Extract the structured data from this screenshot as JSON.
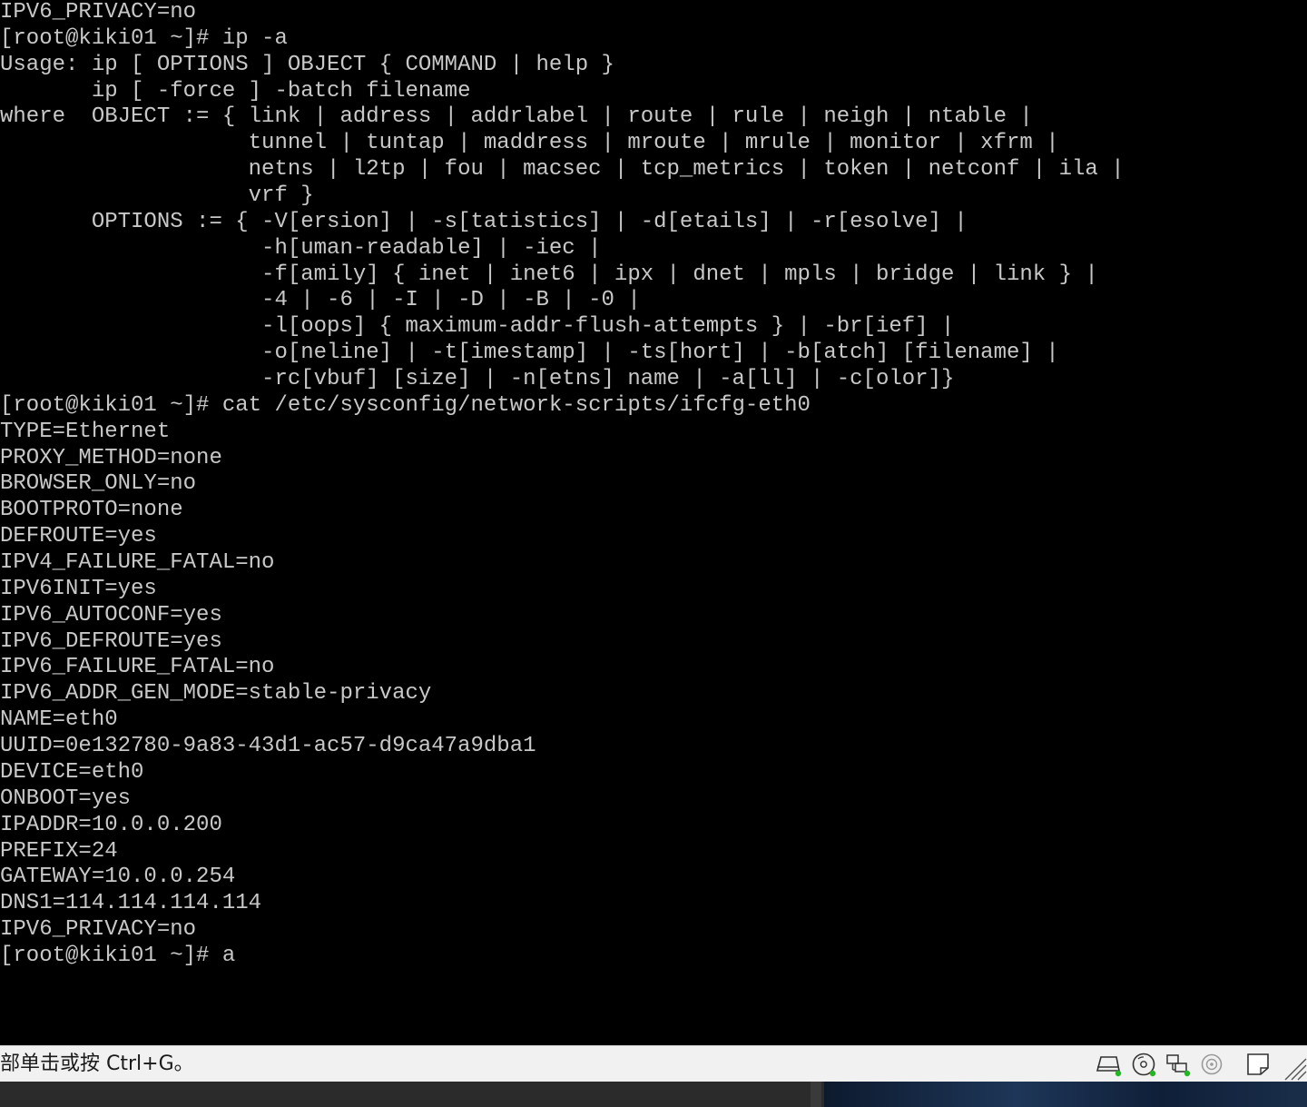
{
  "console": {
    "lines": [
      "IPV6_PRIVACY=no",
      "[root@kiki01 ~]# ip -a",
      "Usage: ip [ OPTIONS ] OBJECT { COMMAND | help }",
      "       ip [ -force ] -batch filename",
      "where  OBJECT := { link | address | addrlabel | route | rule | neigh | ntable |",
      "                   tunnel | tuntap | maddress | mroute | mrule | monitor | xfrm |",
      "                   netns | l2tp | fou | macsec | tcp_metrics | token | netconf | ila |",
      "                   vrf }",
      "       OPTIONS := { -V[ersion] | -s[tatistics] | -d[etails] | -r[esolve] |",
      "                    -h[uman-readable] | -iec |",
      "                    -f[amily] { inet | inet6 | ipx | dnet | mpls | bridge | link } |",
      "                    -4 | -6 | -I | -D | -B | -0 |",
      "                    -l[oops] { maximum-addr-flush-attempts } | -br[ief] |",
      "                    -o[neline] | -t[imestamp] | -ts[hort] | -b[atch] [filename] |",
      "                    -rc[vbuf] [size] | -n[etns] name | -a[ll] | -c[olor]}",
      "[root@kiki01 ~]# cat /etc/sysconfig/network-scripts/ifcfg-eth0",
      "TYPE=Ethernet",
      "PROXY_METHOD=none",
      "BROWSER_ONLY=no",
      "BOOTPROTO=none",
      "DEFROUTE=yes",
      "IPV4_FAILURE_FATAL=no",
      "IPV6INIT=yes",
      "IPV6_AUTOCONF=yes",
      "IPV6_DEFROUTE=yes",
      "IPV6_FAILURE_FATAL=no",
      "IPV6_ADDR_GEN_MODE=stable-privacy",
      "NAME=eth0",
      "UUID=0e132780-9a83-43d1-ac57-d9ca47a9dba1",
      "DEVICE=eth0",
      "ONBOOT=yes",
      "IPADDR=10.0.0.200",
      "PREFIX=24",
      "GATEWAY=10.0.0.254",
      "DNS1=114.114.114.114",
      "IPV6_PRIVACY=no",
      "[root@kiki01 ~]# a"
    ]
  },
  "statusbar": {
    "hint": "部单击或按 Ctrl+G。",
    "devices": [
      {
        "icon": "hard-disk-icon"
      },
      {
        "icon": "cd-dvd-icon"
      },
      {
        "icon": "network-adapter-icon"
      },
      {
        "icon": "sound-card-icon"
      },
      {
        "icon": "message-log-icon"
      },
      {
        "icon": "resize-grip-icon"
      }
    ]
  },
  "colors": {
    "console_bg": "#000000",
    "console_fg": "#c8c8c8",
    "statusbar_bg": "#f1f1f1",
    "status_led": "#26b526",
    "taskbar_bg": "#2b2b2b"
  }
}
